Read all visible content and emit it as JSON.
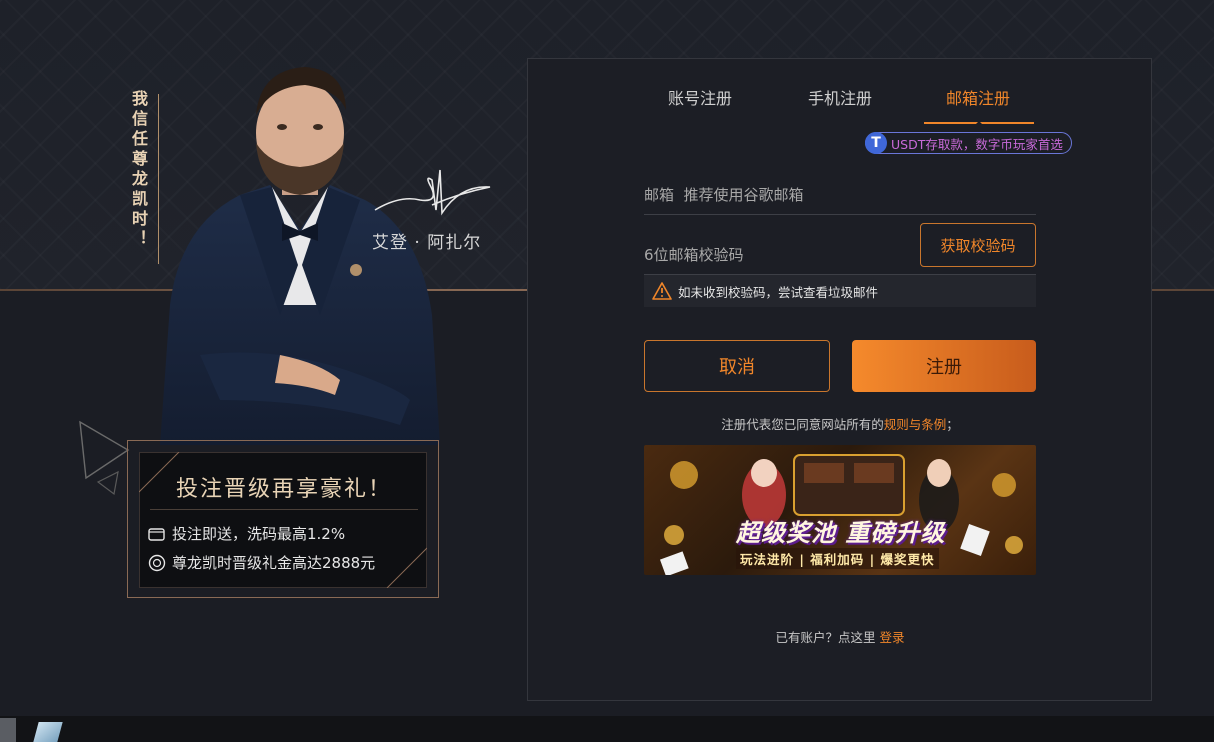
{
  "promo": {
    "slogan": "我信任尊龙凯时！",
    "ambassador_name": "艾登 · 阿扎尔",
    "box_title": "投注晋级再享豪礼！",
    "line1": "投注即送，洗码最高1.2%",
    "line2": "尊龙凯时晋级礼金高达2888元"
  },
  "tabs": [
    {
      "label": "账号注册"
    },
    {
      "label": "手机注册"
    },
    {
      "label": "邮箱注册"
    }
  ],
  "usdt_badge": {
    "icon_char": "T",
    "text": "USDT存取款，数字币玩家首选"
  },
  "form": {
    "email_placeholder": "邮箱  推荐使用谷歌邮箱",
    "code_placeholder": "6位邮箱校验码",
    "get_code_label": "获取校验码",
    "warning": "如未收到校验码，尝试查看垃圾邮件",
    "cancel_label": "取消",
    "submit_label": "注册",
    "agree_prefix": "注册代表您已同意网站所有的",
    "agree_link": "规则与条例",
    "agree_suffix": "；"
  },
  "banner": {
    "title": "超级奖池 重磅升级",
    "subtitle": "玩法进阶 | 福利加码 | 爆奖更快"
  },
  "footer": {
    "prefix": "已有账户？点这里 ",
    "login_link": "登录"
  },
  "colors": {
    "accent": "#f0862a",
    "background": "#1b1d24",
    "panel": "#1c1e25"
  }
}
